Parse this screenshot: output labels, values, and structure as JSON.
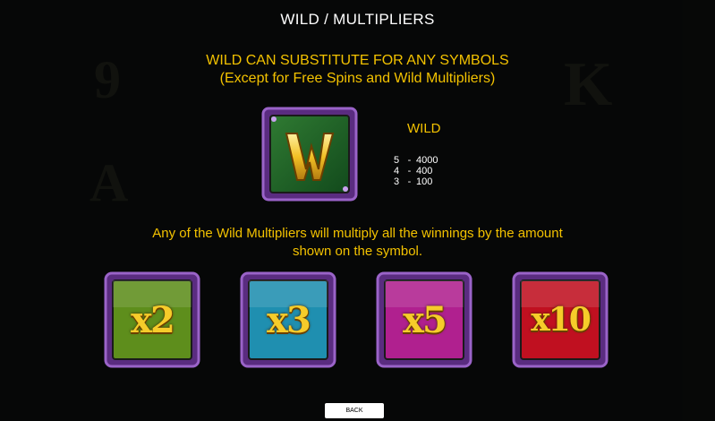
{
  "title": "WILD / MULTIPLIERS",
  "headline": {
    "line1": "WILD CAN SUBSTITUTE FOR ANY SYMBOLS",
    "line2": "(Except for Free Spins and Wild Multipliers)"
  },
  "wild": {
    "icon": "wild-w-symbol",
    "title": "WILD",
    "paytable": [
      {
        "count": "5",
        "payout": "4000"
      },
      {
        "count": "4",
        "payout": "400"
      },
      {
        "count": "3",
        "payout": "100"
      }
    ]
  },
  "description": {
    "line1": "Any of the Wild Multipliers will multiply all the winnings by the amount",
    "line2": "shown on the symbol."
  },
  "multipliers": [
    {
      "label": "x2",
      "color": "#5e8e1c"
    },
    {
      "label": "x3",
      "color": "#1f8fb0"
    },
    {
      "label": "x5",
      "color": "#b0208f"
    },
    {
      "label": "x10",
      "color": "#c01020"
    }
  ],
  "back_label": "BACK",
  "colors": {
    "accent": "#f3c200",
    "frame": "#7a3fa8"
  }
}
